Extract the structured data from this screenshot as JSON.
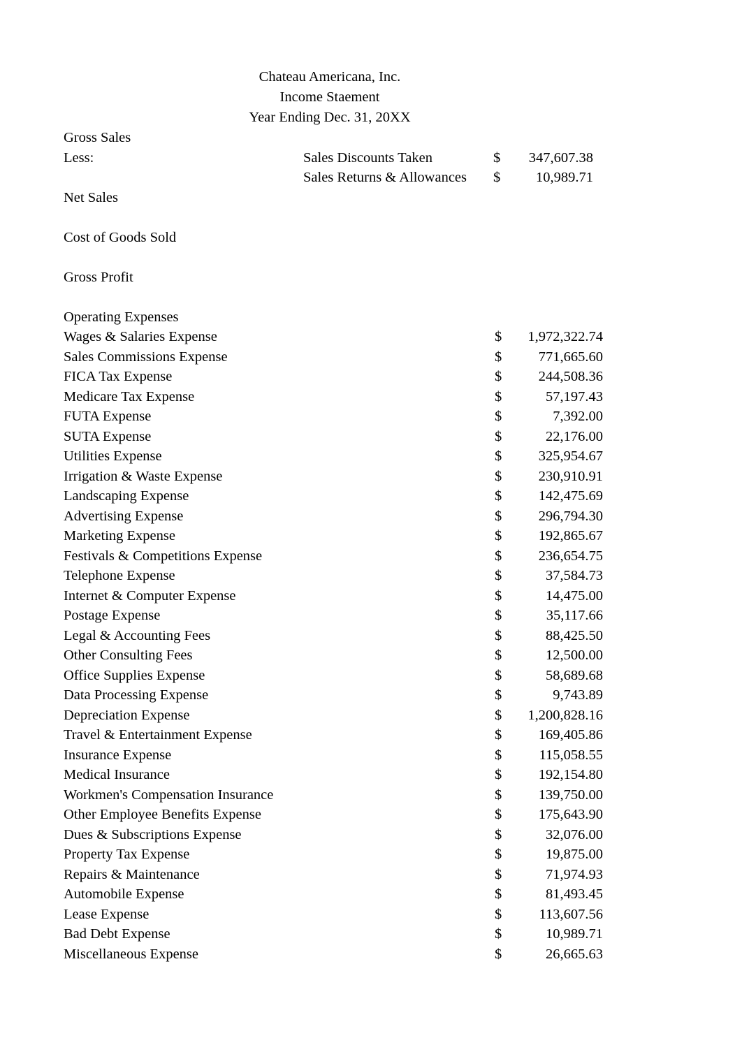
{
  "document": {
    "company": "Chateau Americana, Inc.",
    "statement_title": "Income Staement",
    "period": "Year Ending Dec. 31, 20XX"
  },
  "sections": {
    "gross_sales_label": "Gross Sales",
    "less_label": "Less:",
    "net_sales_label": "Net Sales",
    "cogs_label": "Cost of Goods Sold",
    "gross_profit_label": "Gross Profit",
    "operating_expenses_label": "Operating Expenses"
  },
  "deductions": [
    {
      "label": "Sales Discounts Taken",
      "currency": "$",
      "amount": "347,607.38"
    },
    {
      "label": "Sales Returns & Allowances",
      "currency": "$",
      "amount": "10,989.71"
    }
  ],
  "expenses": [
    {
      "label": "Wages & Salaries Expense",
      "currency": "$",
      "amount": "1,972,322.74"
    },
    {
      "label": "Sales Commissions Expense",
      "currency": "$",
      "amount": "771,665.60"
    },
    {
      "label": "FICA Tax Expense",
      "currency": "$",
      "amount": "244,508.36"
    },
    {
      "label": "Medicare Tax Expense",
      "currency": "$",
      "amount": "57,197.43"
    },
    {
      "label": "FUTA Expense",
      "currency": "$",
      "amount": "7,392.00"
    },
    {
      "label": "SUTA Expense",
      "currency": "$",
      "amount": "22,176.00"
    },
    {
      "label": "Utilities Expense",
      "currency": "$",
      "amount": "325,954.67"
    },
    {
      "label": "Irrigation & Waste Expense",
      "currency": "$",
      "amount": "230,910.91"
    },
    {
      "label": "Landscaping Expense",
      "currency": "$",
      "amount": "142,475.69"
    },
    {
      "label": "Advertising Expense",
      "currency": "$",
      "amount": "296,794.30"
    },
    {
      "label": "Marketing Expense",
      "currency": "$",
      "amount": "192,865.67"
    },
    {
      "label": "Festivals & Competitions Expense",
      "currency": "$",
      "amount": "236,654.75"
    },
    {
      "label": "Telephone Expense",
      "currency": "$",
      "amount": "37,584.73"
    },
    {
      "label": "Internet & Computer Expense",
      "currency": "$",
      "amount": "14,475.00"
    },
    {
      "label": "Postage Expense",
      "currency": "$",
      "amount": "35,117.66"
    },
    {
      "label": "Legal & Accounting Fees",
      "currency": "$",
      "amount": "88,425.50"
    },
    {
      "label": "Other Consulting Fees",
      "currency": "$",
      "amount": "12,500.00"
    },
    {
      "label": "Office Supplies Expense",
      "currency": "$",
      "amount": "58,689.68"
    },
    {
      "label": "Data Processing Expense",
      "currency": "$",
      "amount": "9,743.89"
    },
    {
      "label": "Depreciation Expense",
      "currency": "$",
      "amount": "1,200,828.16"
    },
    {
      "label": "Travel & Entertainment Expense",
      "currency": "$",
      "amount": "169,405.86"
    },
    {
      "label": "Insurance Expense",
      "currency": "$",
      "amount": "115,058.55"
    },
    {
      "label": "Medical Insurance",
      "currency": "$",
      "amount": "192,154.80"
    },
    {
      "label": "Workmen's Compensation Insurance",
      "currency": "$",
      "amount": "139,750.00"
    },
    {
      "label": "Other Employee Benefits Expense",
      "currency": "$",
      "amount": "175,643.90"
    },
    {
      "label": "Dues & Subscriptions Expense",
      "currency": "$",
      "amount": "32,076.00"
    },
    {
      "label": "Property Tax Expense",
      "currency": "$",
      "amount": "19,875.00"
    },
    {
      "label": "Repairs & Maintenance",
      "currency": "$",
      "amount": "71,974.93"
    },
    {
      "label": "Automobile Expense",
      "currency": "$",
      "amount": "81,493.45"
    },
    {
      "label": "Lease Expense",
      "currency": "$",
      "amount": "113,607.56"
    },
    {
      "label": "Bad Debt Expense",
      "currency": "$",
      "amount": "10,989.71"
    },
    {
      "label": "Miscellaneous Expense",
      "currency": "$",
      "amount": "26,665.63"
    }
  ]
}
